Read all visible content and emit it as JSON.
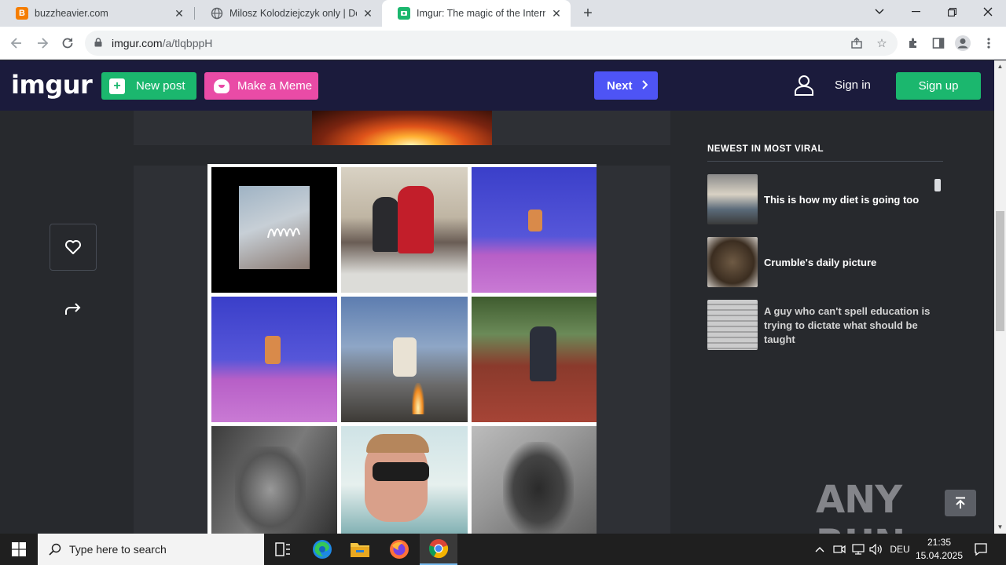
{
  "browser": {
    "tabs": [
      {
        "title": "buzzheavier.com",
        "favicon": "blogger-icon",
        "active": false
      },
      {
        "title": "Milosz Kolodziejczyk only | Doxb",
        "favicon": "globe-icon",
        "active": false
      },
      {
        "title": "Imgur: The magic of the Internet",
        "favicon": "imgur-icon",
        "active": true
      }
    ],
    "url_host": "imgur.com",
    "url_path": "/a/tlqbppH"
  },
  "imgur": {
    "logo": "imgur",
    "new_post": "New post",
    "make_meme": "Make a Meme",
    "next": "Next",
    "sign_in": "Sign in",
    "sign_up": "Sign up"
  },
  "sidebar": {
    "title": "NEWEST IN MOST VIRAL",
    "items": [
      {
        "title": "This is how my diet is going too"
      },
      {
        "title": "Crumble's daily picture"
      },
      {
        "title": "A guy who can't spell education is trying to dictate what should be taught"
      }
    ]
  },
  "watermark": "ANY RUN",
  "taskbar": {
    "search_placeholder": "Type here to search",
    "language": "DEU",
    "time": "21:35",
    "date": "15.04.2025"
  },
  "colors": {
    "imgur_header": "#1b1b3c",
    "new_post_green": "#1bb76e",
    "meme_pink": "#e94ba6",
    "next_blue": "#4e54f5",
    "page_bg": "#27292d"
  }
}
